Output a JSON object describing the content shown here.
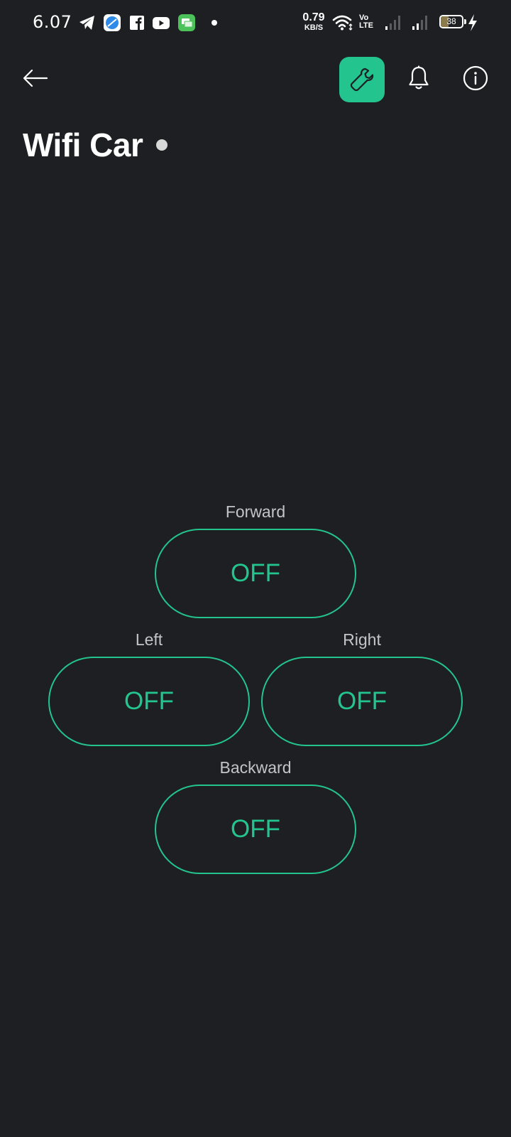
{
  "status_bar": {
    "time": "6.07",
    "net_speed_value": "0.79",
    "net_speed_unit": "KB/S",
    "volte_top": "Vo",
    "volte_bottom": "LTE",
    "battery_percent": "38",
    "battery_level": 0.38,
    "notification_icons": [
      "telegram-icon",
      "browser-icon",
      "facebook-icon",
      "youtube-icon",
      "messages-icon"
    ],
    "system_icons": [
      "wifi-icon",
      "volte-icon",
      "signal-icon",
      "signal-icon",
      "battery-icon",
      "charging-icon"
    ]
  },
  "toolbar": {
    "back_icon": "arrow-left-icon",
    "wrench_icon": "wrench-icon",
    "bell_icon": "bell-icon",
    "info_icon": "info-icon",
    "accent_color": "#23C48E"
  },
  "page": {
    "title": "Wifi Car",
    "background_color": "#1E1F22",
    "status_dot_color": "#D8D8D8"
  },
  "controls": {
    "forward": {
      "label": "Forward",
      "state": "OFF"
    },
    "left": {
      "label": "Left",
      "state": "OFF"
    },
    "right": {
      "label": "Right",
      "state": "OFF"
    },
    "backward": {
      "label": "Backward",
      "state": "OFF"
    }
  }
}
